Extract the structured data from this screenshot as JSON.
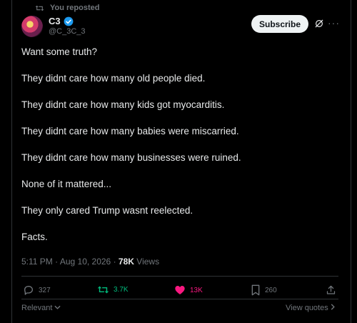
{
  "repost_label": "You reposted",
  "author": {
    "name": "C3",
    "handle": "@C_3C_3"
  },
  "subscribe_label": "Subscribe",
  "more_label": "···",
  "post_lines": [
    "Want some truth?",
    "They didnt care how many old people died.",
    "They didnt care how many kids got myocarditis.",
    "They didnt care how many babies were miscarried.",
    "They didnt care how many businesses were ruined.",
    "None of it mattered...",
    "They only cared Trump wasnt reelected.",
    "Facts."
  ],
  "meta": {
    "time": "5:11 PM",
    "date": "Aug 10, 2026",
    "views_count": "78K",
    "views_label": "Views"
  },
  "actions": {
    "replies": "327",
    "reposts": "3.7K",
    "likes": "13K",
    "bookmarks": "260"
  },
  "colors": {
    "repost_active": "#00ba7c",
    "like_active": "#f91880",
    "verified": "#1d9bf0"
  },
  "footer": {
    "relevant": "Relevant",
    "view_quotes": "View quotes"
  }
}
